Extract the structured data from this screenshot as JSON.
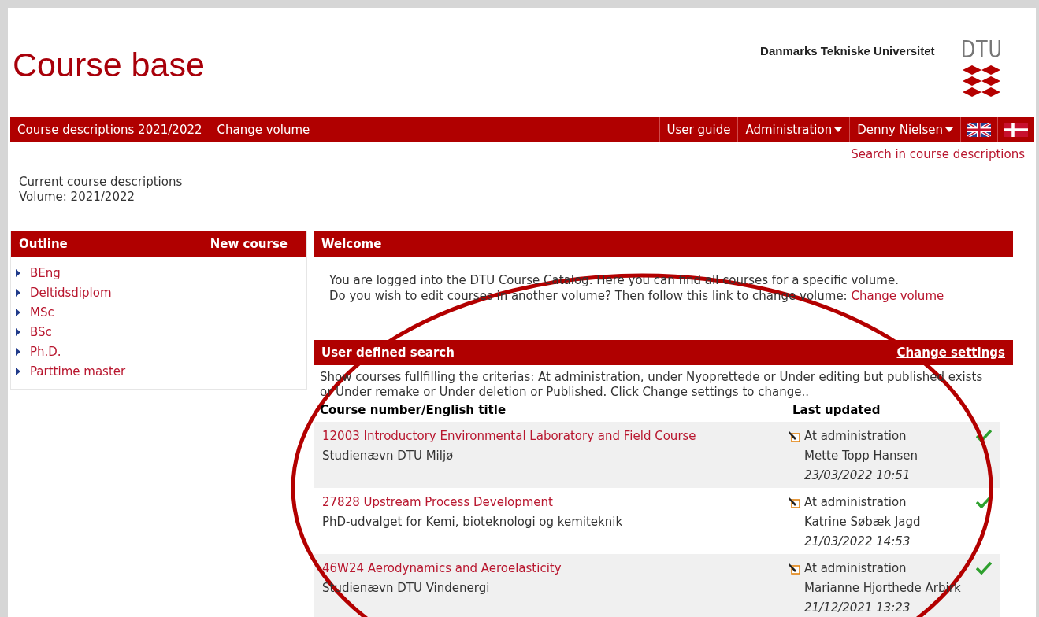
{
  "header": {
    "title": "Course base",
    "university": "Danmarks Tekniske Universitet",
    "logo_text": "DTU"
  },
  "nav": {
    "left": [
      {
        "label": "Course descriptions 2021/2022",
        "kind": "link"
      },
      {
        "label": "Change volume",
        "kind": "link"
      }
    ],
    "right": [
      {
        "label": "User guide",
        "kind": "link"
      },
      {
        "label": "Administration",
        "kind": "dropdown"
      },
      {
        "label": "Denny Nielsen",
        "kind": "dropdown"
      }
    ]
  },
  "search_link": "Search in course descriptions",
  "current": {
    "line1": "Current course descriptions",
    "line2": "Volume: 2021/2022"
  },
  "outline": {
    "title": "Outline",
    "action": "New course",
    "items": [
      "BEng",
      "Deltidsdiplom",
      "MSc",
      "BSc",
      "Ph.D.",
      "Parttime master"
    ]
  },
  "welcome": {
    "title": "Welcome",
    "line1": "You are logged into the DTU Course Catalog. Here you can find all courses for a specific volume.",
    "line2": "Do you wish to edit courses in another volume? Then follow this link to change volume:",
    "link": "Change volume"
  },
  "search": {
    "title": "User defined search",
    "action": "Change settings",
    "description": "Show courses fullfilling the criterias: At administration, under Nyoprettede or Under editing but published exists or Under remake or Under deletion or Published. Click Change settings to change..",
    "columns": [
      "Course number/English title",
      "Last updated"
    ],
    "rows": [
      {
        "title": "12003 Introductory Environmental Laboratory and Field Course",
        "owner": "Studienævn DTU Miljø",
        "status": "At administration",
        "person": "Mette Topp Hansen",
        "date": "23/03/2022 10:51",
        "approved": true
      },
      {
        "title": "27828 Upstream Process Development",
        "owner": "PhD-udvalget for Kemi, bioteknologi og kemiteknik",
        "status": "At administration",
        "person": "Katrine Søbæk Jagd",
        "date": "21/03/2022 14:53",
        "approved": true
      },
      {
        "title": "46W24 Aerodynamics and Aeroelasticity",
        "owner": "Studienævn DTU Vindenergi",
        "status": "At administration",
        "person": "Marianne Hjorthede Arbirk",
        "date": "21/12/2021 13:23",
        "approved": true
      }
    ]
  }
}
